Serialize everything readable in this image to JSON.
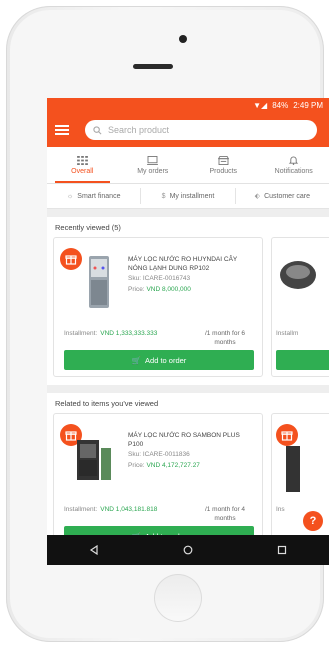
{
  "status_bar": {
    "signal": "▼◢",
    "battery": "84%",
    "time": "2:49 PM"
  },
  "search": {
    "placeholder": "Search product"
  },
  "tabs": [
    {
      "label": "Overall",
      "icon": "grid-icon",
      "active": true
    },
    {
      "label": "My orders",
      "icon": "laptop-icon",
      "active": false
    },
    {
      "label": "Products",
      "icon": "shop-icon",
      "active": false
    },
    {
      "label": "Notifications",
      "icon": "bell-icon",
      "active": false
    }
  ],
  "quick_links": [
    {
      "label": "Smart finance",
      "icon": "bulb-icon"
    },
    {
      "label": "My installment",
      "icon": "dollar-icon"
    },
    {
      "label": "Customer care",
      "icon": "tag-icon"
    }
  ],
  "recent": {
    "title": "Recently viewed (5)",
    "card": {
      "name": "MÁY LỌC NƯỚC RO HUYNDAI CÂY NÓNG LẠNH DUNG RP102",
      "sku_label": "Sku:",
      "sku": "ICARE-0016743",
      "price_label": "Price:",
      "price": "VND 8,000,000",
      "installment_label": "Installment:",
      "installment": "VND 1,333,333.333",
      "terms": "/1 month for 6 months",
      "button": "Add to order"
    },
    "peek_label": "Installm"
  },
  "related": {
    "title": "Related to items you've viewed",
    "card": {
      "name": "MÁY LỌC NƯỚC RO SAMBON PLUS P100",
      "sku_label": "Sku:",
      "sku": "ICARE-0011836",
      "price_label": "Price:",
      "price": "VND 4,172,727.27",
      "installment_label": "Installment:",
      "installment": "VND 1,043,181.818",
      "terms": "/1 month for 4 months",
      "button": "Add to order"
    },
    "peek_label": "Ins"
  },
  "help_label": "?",
  "colors": {
    "brand": "#f4511e",
    "green": "#2fae52"
  }
}
